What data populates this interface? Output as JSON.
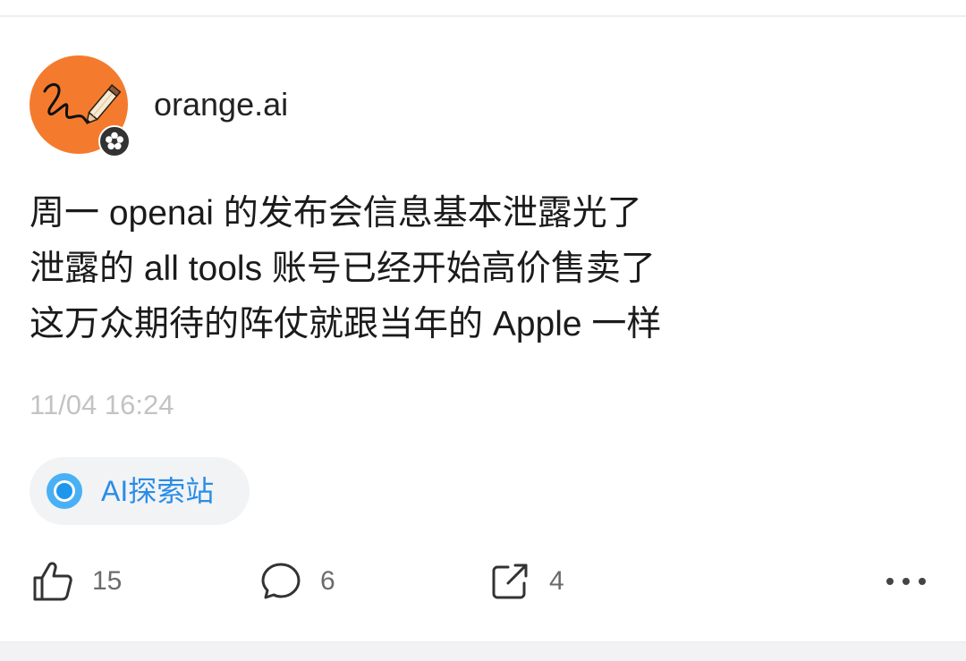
{
  "theme": {
    "accent-orange": "#f47b2d",
    "topic-blue": "#2a8de6",
    "text-primary": "#1b1b1b",
    "text-muted": "#c3c3c3",
    "count-gray": "#6b6b6b"
  },
  "post": {
    "author": {
      "name": "orange.ai",
      "avatar_icon": "pencil-doodle-avatar",
      "badge_icon": "flower-badge-icon"
    },
    "content_lines": [
      "周一 openai 的发布会信息基本泄露光了",
      "泄露的 all tools 账号已经开始高价售卖了",
      "这万众期待的阵仗就跟当年的 Apple 一样"
    ],
    "timestamp": "11/04 16:24",
    "topic": {
      "icon": "topic-circle-icon",
      "label": "AI探索站"
    },
    "actions": {
      "like": {
        "icon": "thumbs-up-icon",
        "count": "15"
      },
      "comment": {
        "icon": "comment-icon",
        "count": "6"
      },
      "share": {
        "icon": "share-icon",
        "count": "4"
      },
      "more": {
        "icon": "more-icon"
      }
    }
  }
}
